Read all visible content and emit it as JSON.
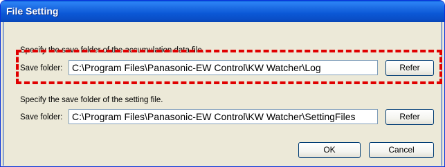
{
  "window": {
    "title": "File Setting"
  },
  "accumulation": {
    "instruction": "Specify the save folder of the accumulation data file.",
    "label": "Save folder:",
    "path": "C:\\Program Files\\Panasonic-EW Control\\KW Watcher\\Log",
    "refer_label": "Refer"
  },
  "setting": {
    "instruction": "Specify the save folder of the setting file.",
    "label": "Save folder:",
    "path": "C:\\Program Files\\Panasonic-EW Control\\KW Watcher\\SettingFiles",
    "refer_label": "Refer"
  },
  "buttons": {
    "ok": "OK",
    "cancel": "Cancel"
  },
  "colors": {
    "highlight": "#e00000",
    "titlebar": "#0a5fd8",
    "dialog_bg": "#ece9d8"
  }
}
